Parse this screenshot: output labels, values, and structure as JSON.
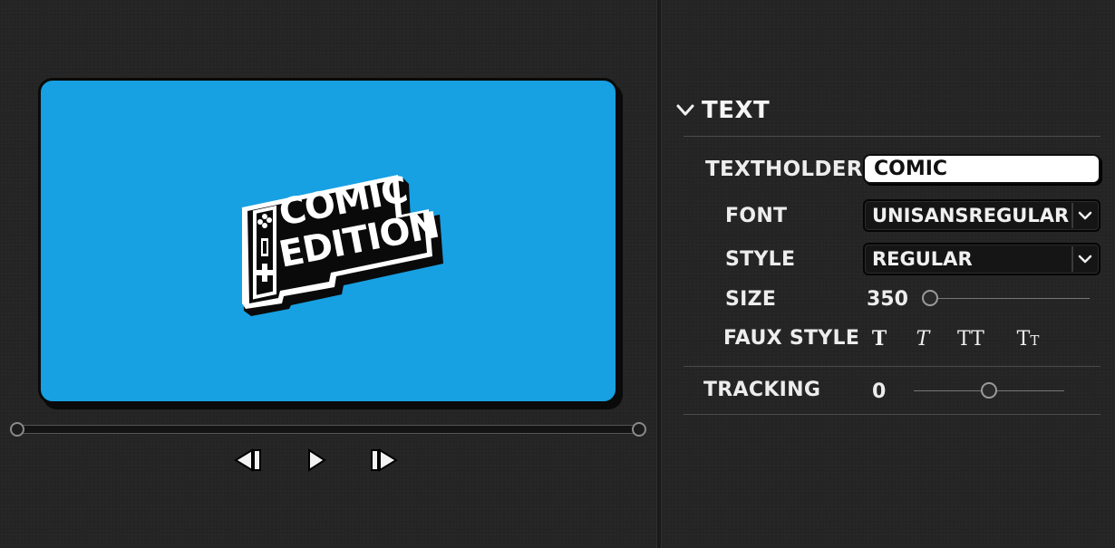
{
  "preview": {
    "logo_text_line1": "COMIC",
    "logo_text_line2": "EDITION",
    "canvas_color": "#17a0e2"
  },
  "transport": {
    "previous_icon": "step-back-icon",
    "play_icon": "play-icon",
    "next_icon": "step-forward-icon"
  },
  "panel": {
    "section_title": "TEXT",
    "section_icon": "chevron-down-icon",
    "textholder": {
      "label": "TEXTHOLDER",
      "value": "COMIC"
    },
    "font": {
      "label": "FONT",
      "value": "UNISANSREGULAR"
    },
    "style": {
      "label": "STYLE",
      "value": "REGULAR"
    },
    "size": {
      "label": "SIZE",
      "value": "350",
      "slider_fraction": 0.0
    },
    "faux_style": {
      "label": "FAUX STYLE",
      "options": [
        "T",
        "T",
        "TT",
        "Tт"
      ]
    },
    "tracking": {
      "label": "TRACKING",
      "value": "0",
      "slider_fraction": 0.5
    }
  }
}
